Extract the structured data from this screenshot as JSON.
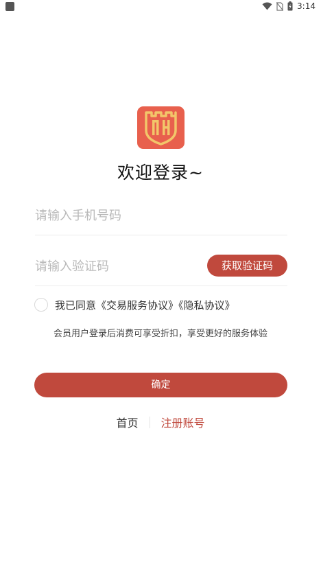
{
  "status_bar": {
    "time": "3:14"
  },
  "login": {
    "title": "欢迎登录~",
    "phone_placeholder": "请输入手机号码",
    "code_placeholder": "请输入验证码",
    "get_code_label": "获取验证码",
    "agree_prefix": "我已同意",
    "agreement_link": "《交易服务协议》",
    "privacy_link": "《隐私协议》",
    "member_note": "会员用户登录后消费可享受折扣，享受更好的服务体验",
    "confirm_label": "确定",
    "home_label": "首页",
    "register_label": "注册账号"
  },
  "colors": {
    "accent": "#c0493d",
    "logo_bg": "#e8604d",
    "logo_gold": "#f2c66a"
  },
  "icons": [
    "square-notification-icon",
    "wifi-icon",
    "no-sim-icon",
    "battery-charging-icon",
    "castle-logo-icon"
  ]
}
